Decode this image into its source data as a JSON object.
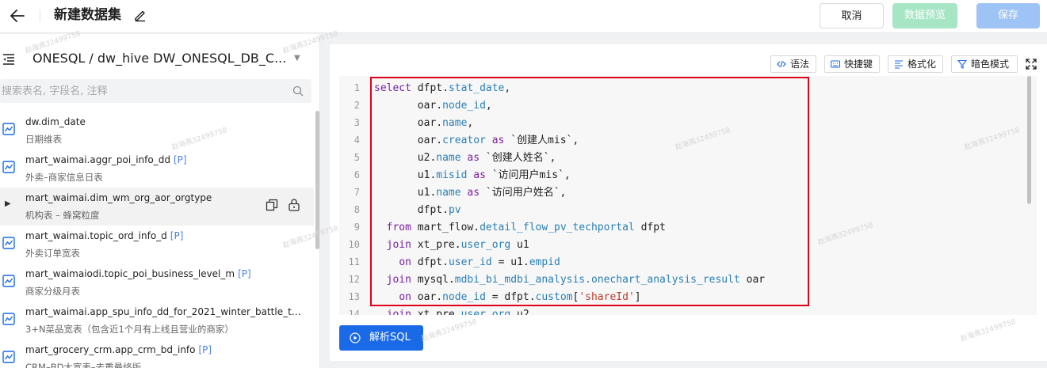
{
  "header": {
    "title": "新建数据集",
    "cancel_label": "取消",
    "preview_label": "数据预览",
    "save_label": "保存"
  },
  "sidebar": {
    "database_selector": "ONESQL / dw_hive DW_ONESQL_DB_C...",
    "search_placeholder": "搜索表名, 字段名, 注释",
    "tables": [
      {
        "name": "dw.dim_date",
        "tag": "",
        "desc": "日期维表"
      },
      {
        "name": "mart_waimai.aggr_poi_info_dd",
        "tag": "[P]",
        "desc": "外卖–商家信息日表"
      },
      {
        "name": "mart_waimai.dim_wm_org_aor_orgtype",
        "tag": "",
        "desc": "机构表 – 蜂窝粒度"
      },
      {
        "name": "mart_waimai.topic_ord_info_d",
        "tag": "[P]",
        "desc": "外卖订单宽表"
      },
      {
        "name": "mart_waimaiodi.topic_poi_business_level_m",
        "tag": "[P]",
        "desc": "商家分级月表"
      },
      {
        "name": "mart_waimai.app_spu_info_dd_for_2021_winter_battle_temp...",
        "tag": "",
        "desc": "3+N菜品宽表（包含近1个月有上线且营业的商家）"
      },
      {
        "name": "mart_grocery_crm.app_crm_bd_info",
        "tag": "[P]",
        "desc": "CRM–BD大宽表–去重最终版"
      }
    ]
  },
  "editor": {
    "toolbar": {
      "syntax_label": "语法",
      "shortcut_label": "快捷键",
      "format_label": "格式化",
      "dark_mode_label": "暗色模式"
    },
    "line_numbers": [
      "1",
      "2",
      "3",
      "4",
      "5",
      "6",
      "7",
      "8",
      "9",
      "10",
      "11",
      "12",
      "13",
      "14"
    ],
    "parse_label": "解析SQL"
  },
  "watermark": "赵海燕32499758",
  "colors": {
    "primary": "#1a6ae8",
    "preview_disabled": "#a6e6c4",
    "save_disabled": "#9dc4f5",
    "highlight_border": "#e0001a",
    "keyword": "#7a1fa2",
    "property": "#2a7fb5",
    "string": "#c0392b"
  }
}
